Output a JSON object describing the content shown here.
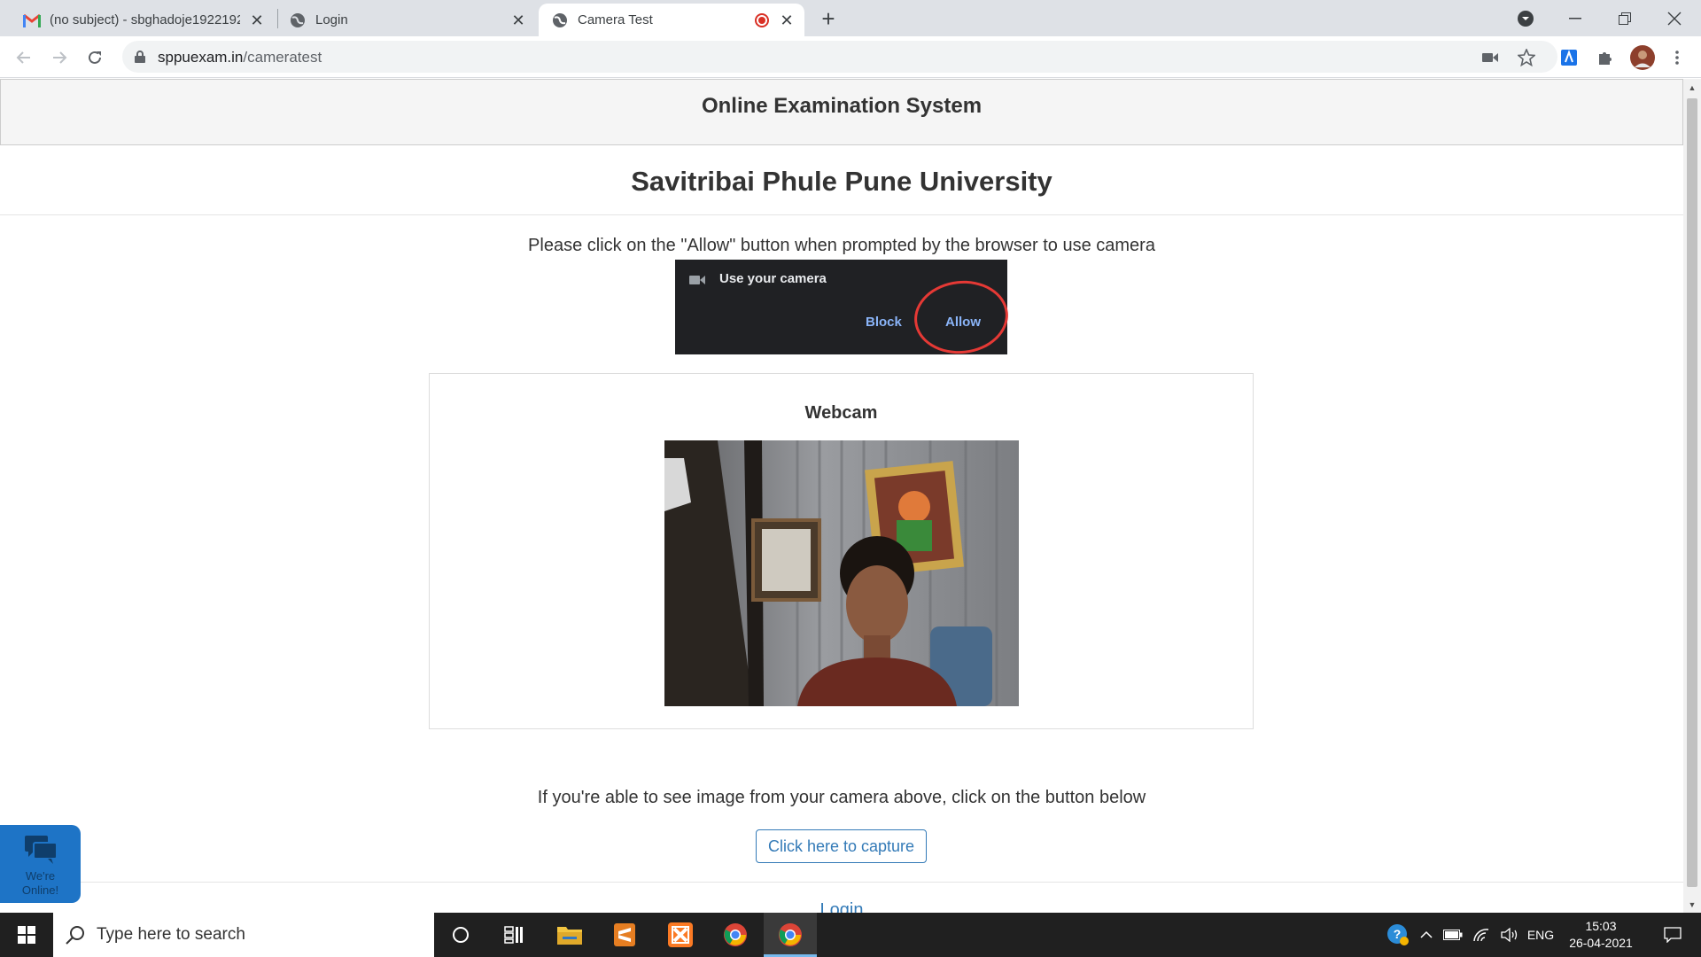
{
  "browser": {
    "tabs": [
      {
        "title": "(no subject) - sbghadoje1922192",
        "icon": "gmail-icon"
      },
      {
        "title": "Login",
        "icon": "globe-icon"
      },
      {
        "title": "Camera Test",
        "icon": "globe-icon",
        "active": true,
        "recording": true
      }
    ],
    "url_host": "sppuexam.in",
    "url_path": "/cameratest"
  },
  "page": {
    "system_title": "Online Examination System",
    "university_title": "Savitribai Phule Pune University",
    "instruction": "Please click on the \"Allow\" button when prompted by the browser to use camera",
    "permission_prompt": {
      "title": "Use your camera",
      "block_label": "Block",
      "allow_label": "Allow"
    },
    "webcam": {
      "title": "Webcam"
    },
    "confirm_text": "If you're able to see image from your camera above, click on the button below",
    "capture_button": "Click here to capture",
    "login_link": "Login",
    "chat_widget": {
      "line1": "We're",
      "line2": "Online!"
    }
  },
  "taskbar": {
    "search_placeholder": "Type here to search",
    "language": "ENG",
    "time": "15:03",
    "date": "26-04-2021"
  },
  "colors": {
    "link_blue": "#337ab7",
    "chat_blue": "#1e74c6",
    "prompt_bg": "#202124",
    "highlight_red": "#e53935"
  }
}
